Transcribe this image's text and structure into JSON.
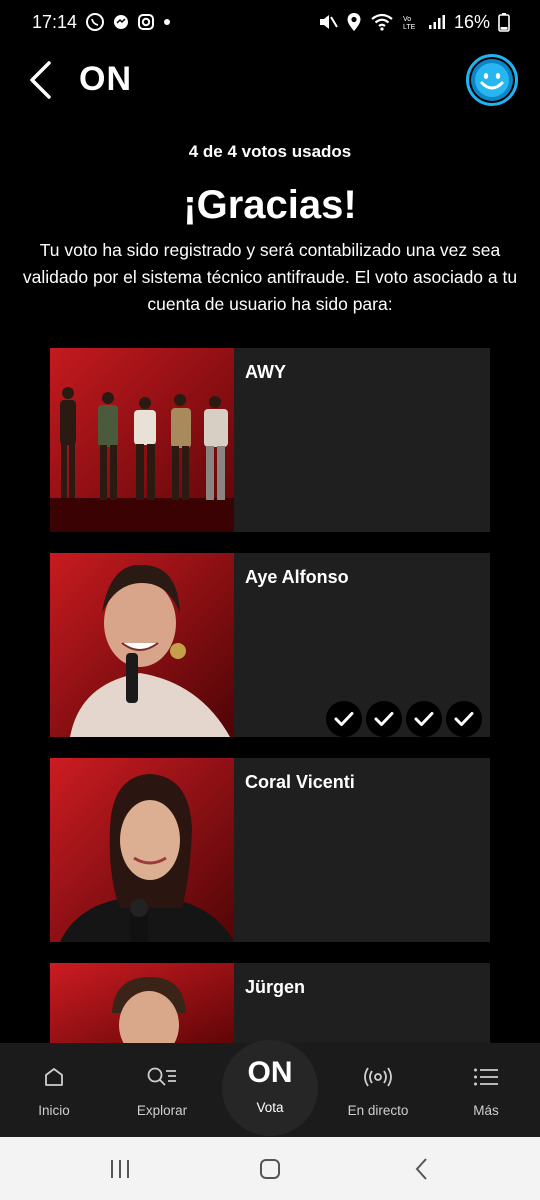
{
  "status_bar": {
    "time": "17:14",
    "battery": "16%"
  },
  "header": {
    "title": "ON"
  },
  "votes_used": "4 de 4 votos usados",
  "thanks": {
    "title": "¡Gracias!",
    "message": "Tu voto ha sido registrado y será contabilizado una vez sea validado por el sistema técnico antifraude. El voto asociado a tu cuenta de usuario ha sido para:"
  },
  "candidates": [
    {
      "name": "AWY",
      "votes": 0
    },
    {
      "name": "Aye Alfonso",
      "votes": 4
    },
    {
      "name": "Coral Vicenti",
      "votes": 0
    },
    {
      "name": "Jürgen",
      "votes": 0
    }
  ],
  "bottom_nav": {
    "inicio": "Inicio",
    "explorar": "Explorar",
    "vota_logo": "ON",
    "vota": "Vota",
    "en_directo": "En directo",
    "mas": "Más"
  },
  "colors": {
    "background": "#000000",
    "card": "#1f1f1f",
    "accent": "#1fb3ef",
    "thumb_red": "#b5121b"
  }
}
